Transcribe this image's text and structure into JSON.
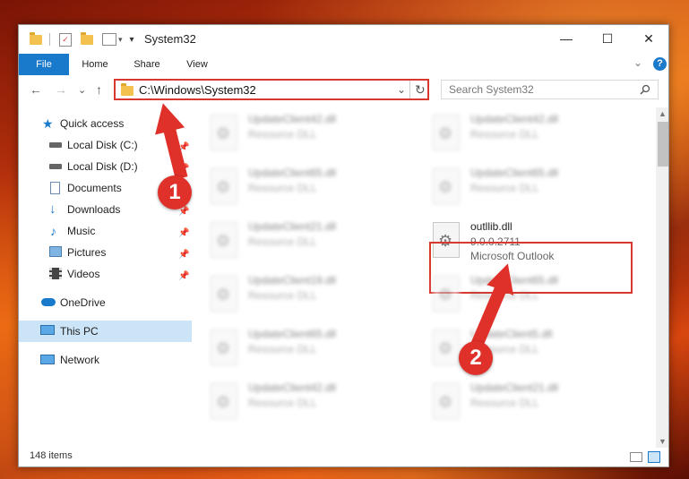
{
  "window": {
    "title": "System32"
  },
  "titlebar": {
    "minimize": "—",
    "maximize": "☐",
    "close": "✕",
    "dropdown": "▾"
  },
  "ribbon": {
    "tabs": [
      "File",
      "Home",
      "Share",
      "View"
    ],
    "collapse": "⌄",
    "help": "?"
  },
  "address": {
    "path": "C:\\Windows\\System32",
    "dropdown": "⌄",
    "refresh": "↻"
  },
  "search": {
    "placeholder": "Search System32",
    "icon": "search-icon"
  },
  "nav": {
    "back": "←",
    "forward": "→",
    "recent": "⌄",
    "up": "↑"
  },
  "sidebar": {
    "items": [
      {
        "label": "Quick access",
        "icon": "star-icon"
      },
      {
        "label": "Local Disk (C:)",
        "icon": "drive-icon",
        "pinned": true
      },
      {
        "label": "Local Disk (D:)",
        "icon": "drive-icon",
        "pinned": true
      },
      {
        "label": "Documents",
        "icon": "documents-icon",
        "pinned": true
      },
      {
        "label": "Downloads",
        "icon": "download-icon",
        "pinned": true
      },
      {
        "label": "Music",
        "icon": "music-icon",
        "pinned": true
      },
      {
        "label": "Pictures",
        "icon": "pictures-icon",
        "pinned": true
      },
      {
        "label": "Videos",
        "icon": "video-icon",
        "pinned": true
      },
      {
        "label": "OneDrive",
        "icon": "cloud-icon"
      },
      {
        "label": "This PC",
        "icon": "computer-icon",
        "selected": true
      },
      {
        "label": "Network",
        "icon": "network-icon"
      }
    ]
  },
  "files": [
    {
      "name": "UpdateClient42.dll",
      "line1": "Resource DLL",
      "line2": ""
    },
    {
      "name": "UpdateClient42.dll",
      "line1": "Resource DLL",
      "line2": ""
    },
    {
      "name": "UpdateClient65.dll",
      "line1": "Resource DLL",
      "line2": ""
    },
    {
      "name": "UpdateClient65.dll",
      "line1": "Resource DLL",
      "line2": ""
    },
    {
      "name": "UpdateClient21.dll",
      "line1": "Resource DLL",
      "line2": ""
    },
    {
      "name": "outllib.dll",
      "line1": "9.0.0.2711",
      "line2": "Microsoft Outlook"
    },
    {
      "name": "UpdateClient19.dll",
      "line1": "Resource DLL",
      "line2": ""
    },
    {
      "name": "UpdateClient65.dll",
      "line1": "Resource DLL",
      "line2": ""
    },
    {
      "name": "UpdateClient65.dll",
      "line1": "Resource DLL",
      "line2": ""
    },
    {
      "name": "UpdateClient5.dll",
      "line1": "Resource DLL",
      "line2": ""
    },
    {
      "name": "UpdateClient42.dll",
      "line1": "Resource DLL",
      "line2": ""
    },
    {
      "name": "UpdateClient21.dll",
      "line1": "Resource DLL",
      "line2": ""
    }
  ],
  "status": {
    "count": "148 items"
  },
  "callouts": [
    "1",
    "2"
  ],
  "colors": {
    "accent": "#1979ca",
    "highlight": "#d9382e",
    "selected": "#cce4f7"
  }
}
